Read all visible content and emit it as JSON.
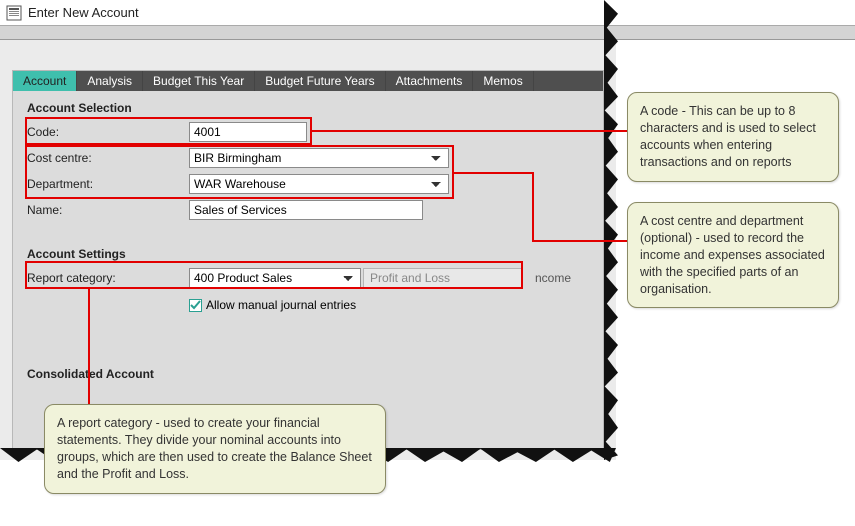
{
  "window": {
    "title": "Enter New Account"
  },
  "tabs": [
    {
      "label": "Account",
      "active": true
    },
    {
      "label": "Analysis",
      "active": false
    },
    {
      "label": "Budget This Year",
      "active": false
    },
    {
      "label": "Budget Future Years",
      "active": false
    },
    {
      "label": "Attachments",
      "active": false
    },
    {
      "label": "Memos",
      "active": false
    }
  ],
  "sections": {
    "account_selection": {
      "title": "Account Selection"
    },
    "account_settings": {
      "title": "Account Settings"
    },
    "consolidated": {
      "title": "Consolidated Account"
    }
  },
  "fields": {
    "code": {
      "label": "Code:",
      "value": "4001"
    },
    "cost_centre": {
      "label": "Cost centre:",
      "value": "BIR Birmingham"
    },
    "department": {
      "label": "Department:",
      "value": "WAR Warehouse"
    },
    "name": {
      "label": "Name:",
      "value": "Sales of Services"
    },
    "report_category": {
      "label": "Report category:",
      "value": "400 Product Sales",
      "type_display": "Profit and Loss",
      "suffix": "ncome"
    },
    "allow_manual": {
      "label": "Allow manual journal entries",
      "checked": true
    }
  },
  "callouts": {
    "code": "A code - This can be up to 8 characters and is used to select accounts when entering transactions and on reports",
    "cost_dept": "A cost centre and department (optional) - used to record the income and expenses associated with the specified parts of an organisation.",
    "report_cat": "A report category - used to create your financial statements. They divide your nominal accounts into groups, which are then used to create the Balance Sheet and the Profit and Loss."
  },
  "colors": {
    "highlight": "#e20000",
    "active_tab": "#3fbfad",
    "callout_bg": "#f1f3da"
  }
}
